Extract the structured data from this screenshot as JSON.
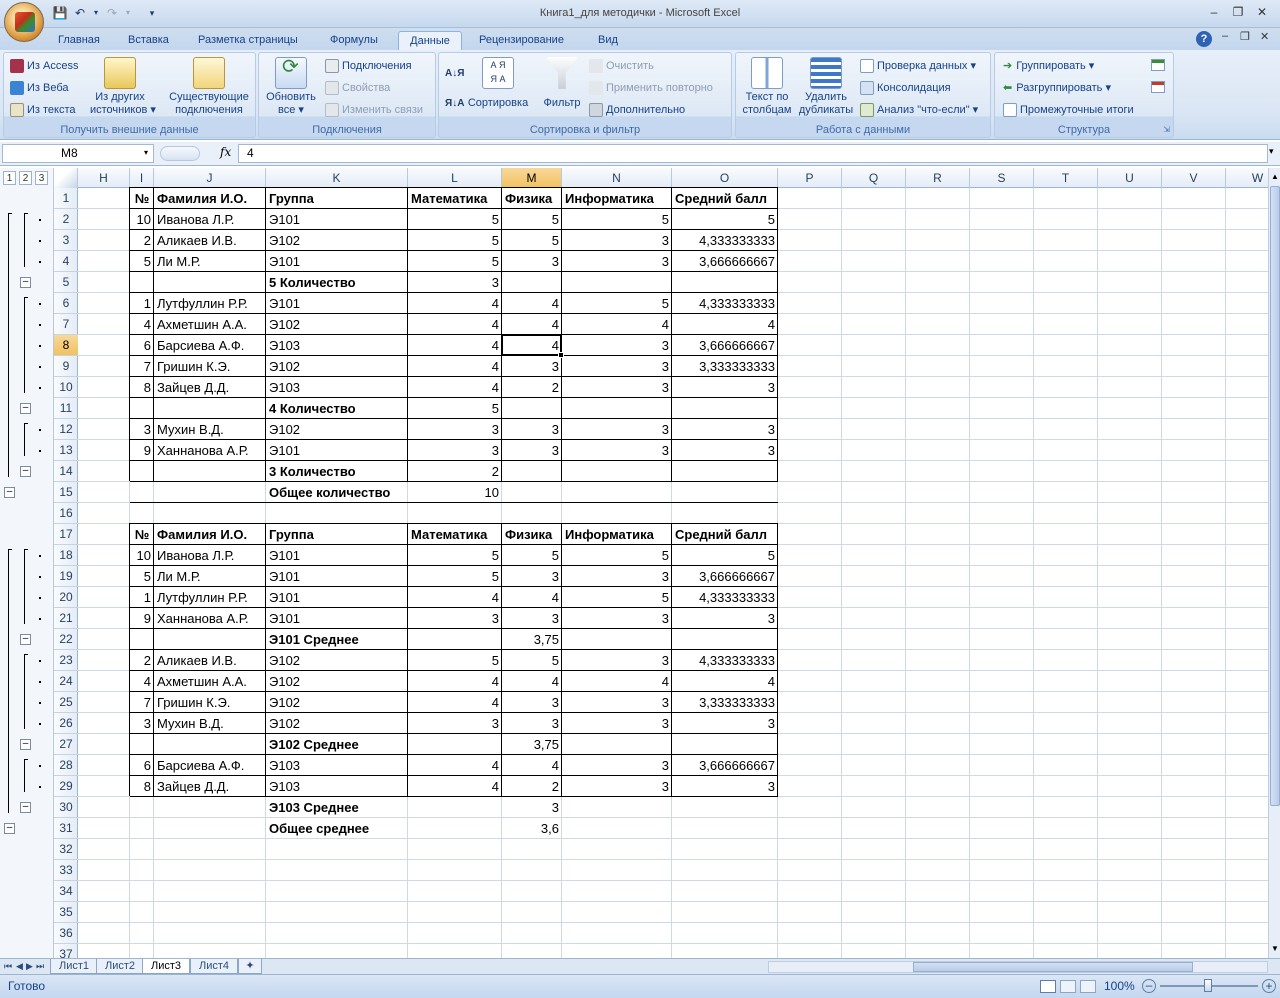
{
  "window": {
    "title": "Книга1_для методички - Microsoft Excel",
    "minimize": "–",
    "restore": "❐",
    "close": "✕",
    "help": "?"
  },
  "quick_access": {
    "save_icon": "save-icon",
    "undo_icon": "undo-icon",
    "redo_icon": "redo-icon"
  },
  "tabs": [
    "Главная",
    "Вставка",
    "Разметка страницы",
    "Формулы",
    "Данные",
    "Рецензирование",
    "Вид"
  ],
  "active_tab": "Данные",
  "ribbon": {
    "external": {
      "label": "Получить внешние данные",
      "from_access": "Из Access",
      "from_web": "Из Веба",
      "from_text": "Из текста",
      "other_sources_1": "Из других",
      "other_sources_2": "источников",
      "existing_1": "Существующие",
      "existing_2": "подключения"
    },
    "connections": {
      "label": "Подключения",
      "refresh_1": "Обновить",
      "refresh_2": "все",
      "connections": "Подключения",
      "properties": "Свойства",
      "edit_links": "Изменить связи"
    },
    "sort_filter": {
      "label": "Сортировка и фильтр",
      "sort": "Сортировка",
      "filter": "Фильтр",
      "clear": "Очистить",
      "reapply": "Применить повторно",
      "advanced": "Дополнительно"
    },
    "data_tools": {
      "label": "Работа с данными",
      "text_to_columns_1": "Текст по",
      "text_to_columns_2": "столбцам",
      "remove_dup_1": "Удалить",
      "remove_dup_2": "дубликаты",
      "validation": "Проверка данных",
      "consolidate": "Консолидация",
      "whatif": "Анализ \"что-если\""
    },
    "outline": {
      "label": "Структура",
      "group": "Группировать",
      "ungroup": "Разгруппировать",
      "subtotal": "Промежуточные итоги"
    }
  },
  "formula_bar": {
    "name_box": "M8",
    "fx": "fx",
    "value": "4"
  },
  "outline_levels": [
    "1",
    "2",
    "3"
  ],
  "columns": [
    "H",
    "I",
    "J",
    "K",
    "L",
    "M",
    "N",
    "O",
    "P",
    "Q",
    "R",
    "S",
    "T",
    "U",
    "V",
    "W"
  ],
  "rows": [
    "1",
    "2",
    "3",
    "4",
    "5",
    "6",
    "7",
    "8",
    "9",
    "10",
    "11",
    "12",
    "13",
    "14",
    "15",
    "16",
    "17",
    "18",
    "19",
    "20",
    "21",
    "22",
    "23",
    "24",
    "25",
    "26",
    "27",
    "28",
    "29",
    "30",
    "31",
    "32",
    "33",
    "34",
    "35",
    "36",
    "37"
  ],
  "table1": {
    "header": [
      "№",
      "Фамилия И.О.",
      "Группа",
      "Математика",
      "Физика",
      "Информатика",
      "Средний балл"
    ],
    "rows": [
      [
        "10",
        "Иванова Л.Р.",
        "Э101",
        "5",
        "5",
        "5",
        "5"
      ],
      [
        "2",
        "Аликаев И.В.",
        "Э102",
        "5",
        "5",
        "3",
        "4,333333333"
      ],
      [
        "5",
        "Ли М.Р.",
        "Э101",
        "5",
        "3",
        "3",
        "3,666666667"
      ],
      [
        "",
        "",
        "5 Количество",
        "3",
        "",
        "",
        ""
      ],
      [
        "1",
        "Лутфуллин Р.Р.",
        "Э101",
        "4",
        "4",
        "5",
        "4,333333333"
      ],
      [
        "4",
        "Ахметшин А.А.",
        "Э102",
        "4",
        "4",
        "4",
        "4"
      ],
      [
        "6",
        "Барсиева А.Ф.",
        "Э103",
        "4",
        "4",
        "3",
        "3,666666667"
      ],
      [
        "7",
        "Гришин К.Э.",
        "Э102",
        "4",
        "3",
        "3",
        "3,333333333"
      ],
      [
        "8",
        "Зайцев Д.Д.",
        "Э103",
        "4",
        "2",
        "3",
        "3"
      ],
      [
        "",
        "",
        "4 Количество",
        "5",
        "",
        "",
        ""
      ],
      [
        "3",
        "Мухин В.Д.",
        "Э102",
        "3",
        "3",
        "3",
        "3"
      ],
      [
        "9",
        "Ханнанова А.Р.",
        "Э101",
        "3",
        "3",
        "3",
        "3"
      ],
      [
        "",
        "",
        "3 Количество",
        "2",
        "",
        "",
        ""
      ],
      [
        "",
        "",
        "Общее количество",
        "10",
        "",
        "",
        ""
      ]
    ]
  },
  "table2": {
    "header": [
      "№",
      "Фамилия И.О.",
      "Группа",
      "Математика",
      "Физика",
      "Информатика",
      "Средний балл"
    ],
    "rows": [
      [
        "10",
        "Иванова Л.Р.",
        "Э101",
        "5",
        "5",
        "5",
        "5"
      ],
      [
        "5",
        "Ли М.Р.",
        "Э101",
        "5",
        "3",
        "3",
        "3,666666667"
      ],
      [
        "1",
        "Лутфуллин Р.Р.",
        "Э101",
        "4",
        "4",
        "5",
        "4,333333333"
      ],
      [
        "9",
        "Ханнанова А.Р.",
        "Э101",
        "3",
        "3",
        "3",
        "3"
      ],
      [
        "",
        "",
        "Э101 Среднее",
        "",
        "3,75",
        "",
        ""
      ],
      [
        "2",
        "Аликаев И.В.",
        "Э102",
        "5",
        "5",
        "3",
        "4,333333333"
      ],
      [
        "4",
        "Ахметшин А.А.",
        "Э102",
        "4",
        "4",
        "4",
        "4"
      ],
      [
        "7",
        "Гришин К.Э.",
        "Э102",
        "4",
        "3",
        "3",
        "3,333333333"
      ],
      [
        "3",
        "Мухин В.Д.",
        "Э102",
        "3",
        "3",
        "3",
        "3"
      ],
      [
        "",
        "",
        "Э102 Среднее",
        "",
        "3,75",
        "",
        ""
      ],
      [
        "6",
        "Барсиева А.Ф.",
        "Э103",
        "4",
        "4",
        "3",
        "3,666666667"
      ],
      [
        "8",
        "Зайцев Д.Д.",
        "Э103",
        "4",
        "2",
        "3",
        "3"
      ],
      [
        "",
        "",
        "Э103 Среднее",
        "",
        "3",
        "",
        ""
      ],
      [
        "",
        "",
        "Общее среднее",
        "",
        "3,6",
        "",
        ""
      ]
    ]
  },
  "sheets": [
    "Лист1",
    "Лист2",
    "Лист3",
    "Лист4"
  ],
  "active_sheet": "Лист3",
  "status": {
    "ready": "Готово",
    "zoom": "100%"
  },
  "colors": {
    "accent": "#15428b",
    "selected_header": "#f1c15f",
    "ribbon_bg": "#dbe6f4"
  }
}
